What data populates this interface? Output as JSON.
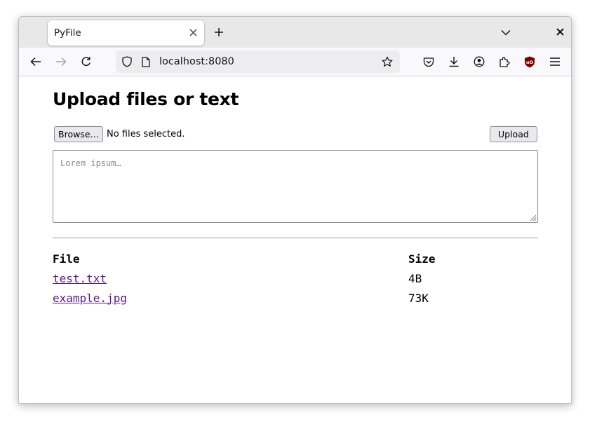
{
  "browser": {
    "tab_title": "PyFile",
    "url": "localhost:8080"
  },
  "icons": {
    "tab_close": "close-icon",
    "new_tab": "plus-icon",
    "tab_list": "chevron-down-icon",
    "window_close": "close-icon",
    "back": "back-arrow-icon",
    "forward": "forward-arrow-icon",
    "reload": "reload-icon",
    "tracking": "shield-icon",
    "page_info": "page-icon",
    "bookmark": "star-icon",
    "pocket": "pocket-icon",
    "downloads": "download-icon",
    "account": "account-icon",
    "extensions": "puzzle-icon",
    "ublock": "ublock-icon",
    "menu": "hamburger-menu-icon"
  },
  "colors": {
    "link_visited": "#551a8b",
    "ublock_red": "#800000"
  },
  "page": {
    "heading": "Upload files or text",
    "browse_label": "Browse…",
    "file_status": "No files selected.",
    "upload_label": "Upload",
    "textarea_placeholder": "Lorem ipsum…",
    "table": {
      "headers": {
        "file": "File",
        "size": "Size"
      },
      "rows": [
        {
          "name": "test.txt",
          "size": "4B"
        },
        {
          "name": "example.jpg",
          "size": "73K"
        }
      ]
    }
  }
}
